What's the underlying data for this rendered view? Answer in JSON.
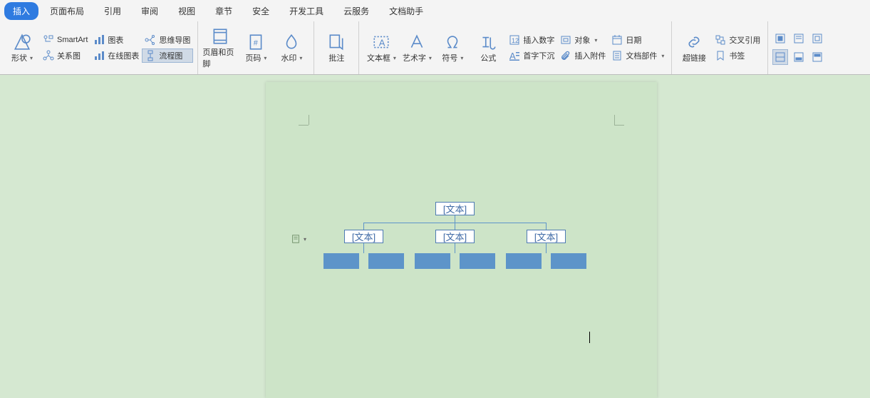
{
  "menu": {
    "tabs": [
      "插入",
      "页面布局",
      "引用",
      "审阅",
      "视图",
      "章节",
      "安全",
      "开发工具",
      "云服务",
      "文档助手"
    ],
    "active": 0
  },
  "ribbon": {
    "g1": {
      "shape": "形状",
      "smartart": "SmartArt",
      "relation": "关系图",
      "chart": "图表",
      "online_chart": "在线图表",
      "mindmap": "思维导图",
      "flowchart": "流程图"
    },
    "g2": {
      "header_footer": "页眉和页脚",
      "page_number": "页码",
      "watermark": "水印"
    },
    "g3": {
      "comment": "批注"
    },
    "g4": {
      "textbox": "文本框",
      "wordart": "艺术字",
      "symbol": "符号",
      "formula": "公式",
      "insert_number": "插入数字",
      "object": "对象",
      "drop_cap": "首字下沉",
      "attachment": "插入附件",
      "date": "日期",
      "doc_parts": "文档部件"
    },
    "g5": {
      "hyperlink": "超链接",
      "cross_ref": "交叉引用",
      "bookmark": "书签"
    }
  },
  "org": {
    "root": "[文本]",
    "level2": [
      "[文本]",
      "[文本]",
      "[文本]"
    ]
  }
}
